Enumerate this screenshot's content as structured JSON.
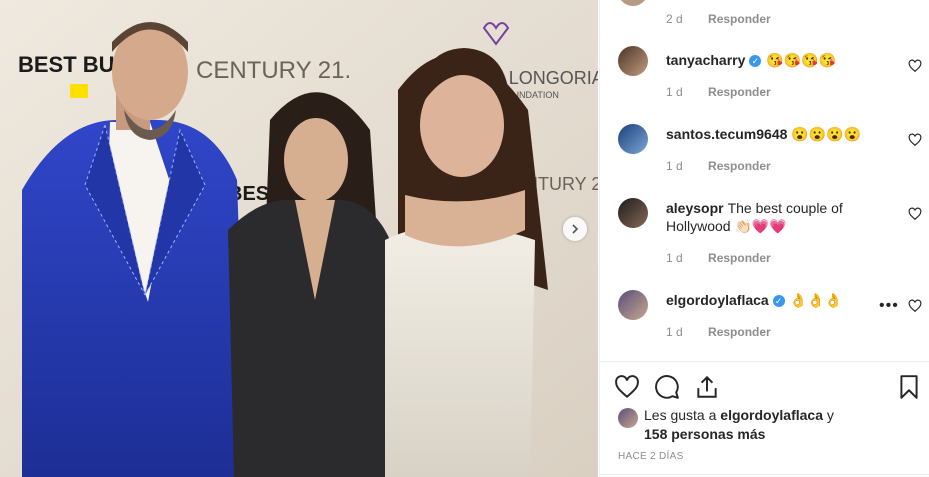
{
  "photo": {
    "description_icon": "photo",
    "backdrop_texts": [
      "BEST BUY",
      "CENTURY 21.",
      "EVA LONGORIA",
      "FOUNDATION",
      "BEST BUY",
      "CENTURY 21."
    ]
  },
  "comments": [
    {
      "time": "2 d",
      "reply": "Responder"
    },
    {
      "username": "tanyacharry",
      "verified": true,
      "text": "😘😘😘😘",
      "time": "1 d",
      "reply": "Responder"
    },
    {
      "username": "santos.tecum9648",
      "verified": false,
      "text": "😮😮😮😮",
      "time": "1 d",
      "reply": "Responder"
    },
    {
      "username": "aleysopr",
      "verified": false,
      "text": "The best couple of Hollywood 👏🏻💗💗",
      "time": "1 d",
      "reply": "Responder"
    },
    {
      "username": "elgordoylaflaca",
      "verified": true,
      "text": "👌👌👌",
      "time": "1 d",
      "reply": "Responder"
    }
  ],
  "more_options": "•••",
  "likes": {
    "prefix": "Les gusta a",
    "user": "elgordoylaflaca",
    "connector": "y",
    "others": "158 personas más"
  },
  "posted_ago": "HACE 2 DÍAS",
  "icons": {
    "like": "heart-icon",
    "comment": "comment-bubble-icon",
    "share": "share-icon",
    "save": "bookmark-icon",
    "next": "chevron-right-icon",
    "verified": "verified-badge-icon"
  },
  "colors": {
    "verified": "#3897f0",
    "meta": "#8e8e8e",
    "text": "#262626",
    "suit": "#2a3fb8"
  }
}
